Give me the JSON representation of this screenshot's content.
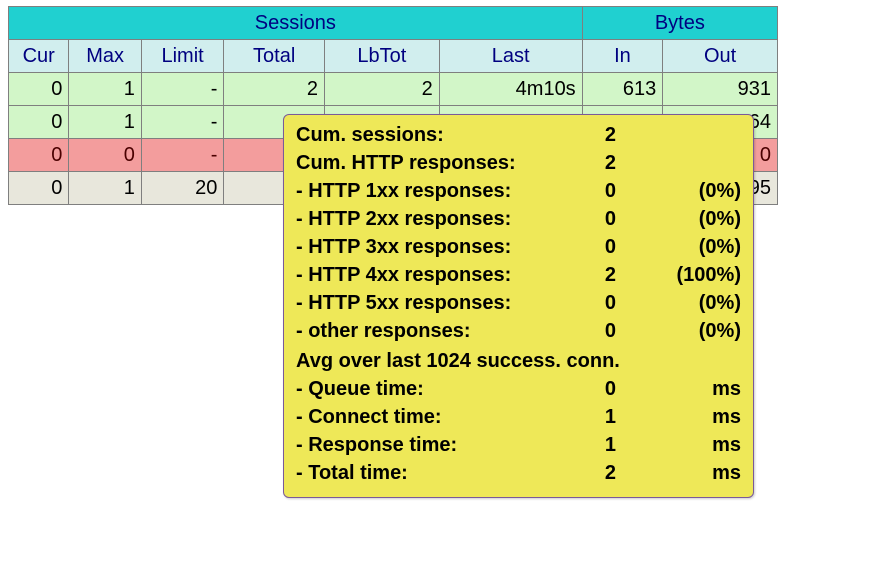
{
  "headers": {
    "group_sessions": "Sessions",
    "group_bytes": "Bytes",
    "cur": "Cur",
    "max": "Max",
    "limit": "Limit",
    "total": "Total",
    "lbtot": "LbTot",
    "last": "Last",
    "in": "In",
    "out": "Out"
  },
  "rows": [
    {
      "cur": "0",
      "max": "1",
      "limit": "-",
      "total": "2",
      "lbtot": "2",
      "last": "4m10s",
      "in": "613",
      "out": "931",
      "cls": "row-green"
    },
    {
      "cur": "0",
      "max": "1",
      "limit": "-",
      "total": "",
      "lbtot": "",
      "last": "",
      "in": "",
      "out": "464",
      "cls": "row-green"
    },
    {
      "cur": "0",
      "max": "0",
      "limit": "-",
      "total": "",
      "lbtot": "",
      "last": "",
      "in": "",
      "out": "0",
      "cls": "row-red"
    },
    {
      "cur": "0",
      "max": "1",
      "limit": "20",
      "total": "",
      "lbtot": "",
      "last": "",
      "in": "",
      "out": "1 395",
      "cls": "row-gray"
    }
  ],
  "tooltip": {
    "cum_sessions_label": "Cum. sessions:",
    "cum_sessions_value": "2",
    "cum_http_label": "Cum. HTTP responses:",
    "cum_http_value": "2",
    "http1xx_label": "- HTTP 1xx responses:",
    "http1xx_value": "0",
    "http1xx_pct": "(0%)",
    "http2xx_label": "- HTTP 2xx responses:",
    "http2xx_value": "0",
    "http2xx_pct": "(0%)",
    "http3xx_label": "- HTTP 3xx responses:",
    "http3xx_value": "0",
    "http3xx_pct": "(0%)",
    "http4xx_label": "- HTTP 4xx responses:",
    "http4xx_value": "2",
    "http4xx_pct": "(100%)",
    "http5xx_label": "- HTTP 5xx responses:",
    "http5xx_value": "0",
    "http5xx_pct": "(0%)",
    "other_label": "- other responses:",
    "other_value": "0",
    "other_pct": "(0%)",
    "avg_heading": "Avg over last 1024 success. conn.",
    "queue_label": "- Queue time:",
    "queue_value": "0",
    "queue_unit": "ms",
    "connect_label": "- Connect time:",
    "connect_value": "1",
    "connect_unit": "ms",
    "resp_label": "- Response time:",
    "resp_value": "1",
    "resp_unit": "ms",
    "total_label": "- Total time:",
    "total_value": "2",
    "total_unit": "ms"
  }
}
